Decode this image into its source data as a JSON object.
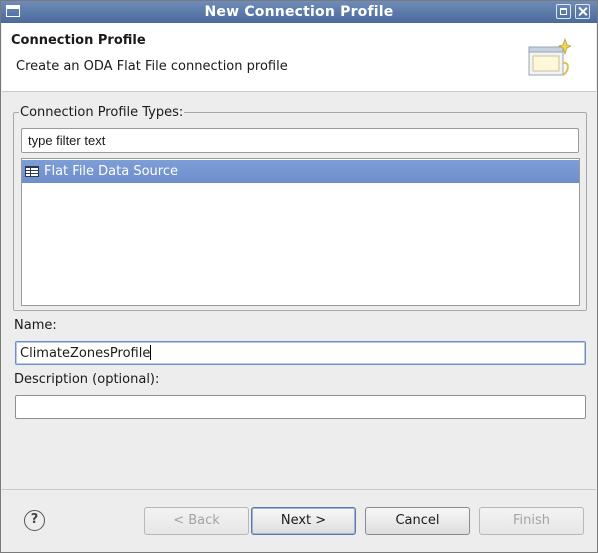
{
  "window": {
    "title": "New Connection Profile"
  },
  "header": {
    "title": "Connection Profile",
    "description": "Create an ODA Flat File connection profile"
  },
  "types": {
    "label": "Connection Profile Types:",
    "filter_placeholder": "type filter text",
    "items": [
      {
        "label": "Flat File Data Source",
        "selected": true,
        "icon": "table-icon"
      }
    ]
  },
  "name": {
    "label": "Name:",
    "value": "ClimateZonesProfile"
  },
  "description": {
    "label": "Description (optional):",
    "value": ""
  },
  "buttons": {
    "help": "?",
    "back": "< Back",
    "next": "Next >",
    "cancel": "Cancel",
    "finish": "Finish"
  },
  "colors": {
    "titlebar": "#5a79aa",
    "selection": "#7596d1"
  }
}
